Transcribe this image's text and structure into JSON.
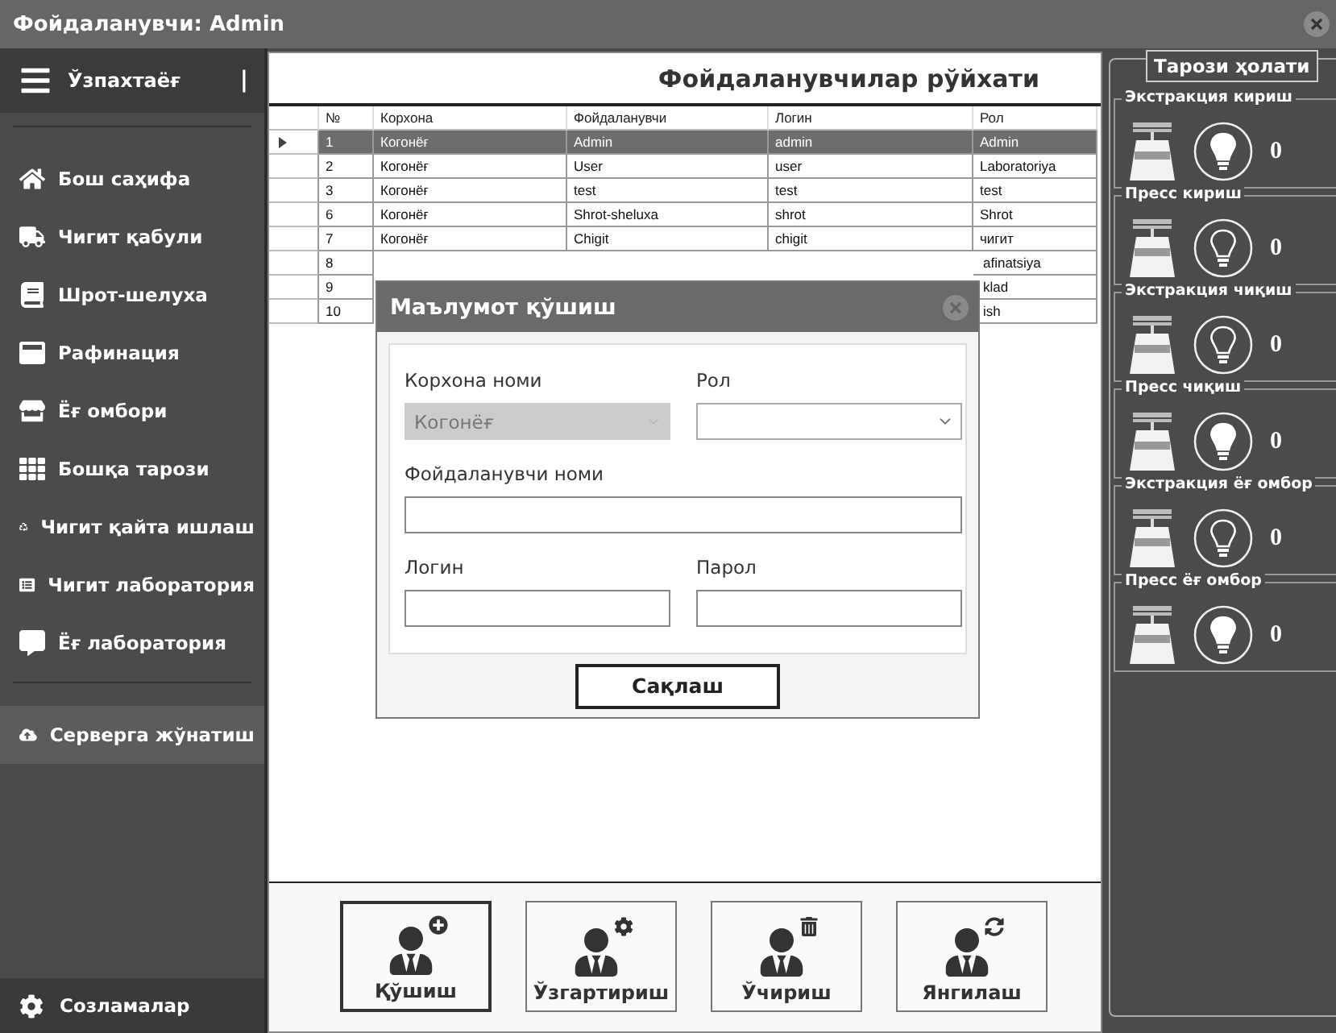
{
  "window": {
    "title": "Фойдаланувчи: Admin"
  },
  "sidebar": {
    "brand": "Ўзпахтаёғ",
    "brand_mark": "|",
    "items": [
      {
        "label": "Бош саҳифа",
        "selected": false
      },
      {
        "label": "Чигит қабули",
        "selected": false
      },
      {
        "label": "Шрот-шелуха",
        "selected": false
      },
      {
        "label": "Рафинация",
        "selected": false
      },
      {
        "label": "Ёғ омбори",
        "selected": false
      },
      {
        "label": "Бошқа тарози",
        "selected": false
      },
      {
        "label": "Чигит қайта ишлаш",
        "selected": false
      },
      {
        "label": "Чигит лаборатория",
        "selected": false
      },
      {
        "label": "Ёғ лаборатория",
        "selected": false
      }
    ],
    "server": {
      "label": "Серверга жўнатиш",
      "selected": true
    },
    "settings": {
      "label": "Созламалар"
    }
  },
  "main": {
    "title": "Фойдаланувчилар рўйхати",
    "table": {
      "columns": [
        "№",
        "Корхона",
        "Фойдаланувчи",
        "Логин",
        "Рол"
      ],
      "rows": [
        {
          "cells": [
            "1",
            "Когонёғ",
            "Admin",
            "admin",
            "Admin"
          ],
          "selected": true
        },
        {
          "cells": [
            "2",
            "Когонёғ",
            "User",
            "user",
            "Laboratoriya"
          ],
          "selected": false
        },
        {
          "cells": [
            "3",
            "Когонёғ",
            "test",
            "test",
            "test"
          ],
          "selected": false
        },
        {
          "cells": [
            "6",
            "Когонёғ",
            "Shrot-sheluxa",
            "shrot",
            "Shrot"
          ],
          "selected": false
        },
        {
          "cells": [
            "7",
            "Когонёғ",
            "Chigit",
            "chigit",
            "чигит"
          ],
          "selected": false
        },
        {
          "cells": [
            "8",
            null,
            null,
            null,
            "afinatsiya"
          ],
          "selected": false
        },
        {
          "cells": [
            "9",
            null,
            null,
            null,
            "klad"
          ],
          "selected": false
        },
        {
          "cells": [
            "10",
            null,
            null,
            null,
            "ish"
          ],
          "selected": false
        }
      ]
    },
    "buttons": [
      {
        "label": "Қўшиш",
        "selected": true
      },
      {
        "label": "Ўзгартириш",
        "selected": false
      },
      {
        "label": "Ўчириш",
        "selected": false
      },
      {
        "label": "Янгилаш",
        "selected": false
      }
    ]
  },
  "dialog": {
    "title": "Маълумот қўшиш",
    "company": {
      "label": "Корхона номи",
      "value": "Когонёғ",
      "disabled": true
    },
    "role": {
      "label": "Рол",
      "disabled": false
    },
    "username": {
      "label": "Фойдаланувчи номи"
    },
    "login": {
      "label": "Логин"
    },
    "password": {
      "label": "Парол"
    },
    "save": "Сақлаш"
  },
  "scales": {
    "title": "Тарози ҳолати",
    "items": [
      {
        "name": "Экстракция кириш",
        "lit": true,
        "reading": "0"
      },
      {
        "name": "Пресс кириш",
        "lit": false,
        "reading": "0"
      },
      {
        "name": "Экстракция чиқиш",
        "lit": false,
        "reading": "0"
      },
      {
        "name": "Пресс чиқиш",
        "lit": true,
        "reading": "0"
      },
      {
        "name": "Экстракция ёғ омбор",
        "lit": false,
        "reading": "0"
      },
      {
        "name": "Пресс ёғ омбор",
        "lit": true,
        "reading": "0"
      }
    ]
  }
}
